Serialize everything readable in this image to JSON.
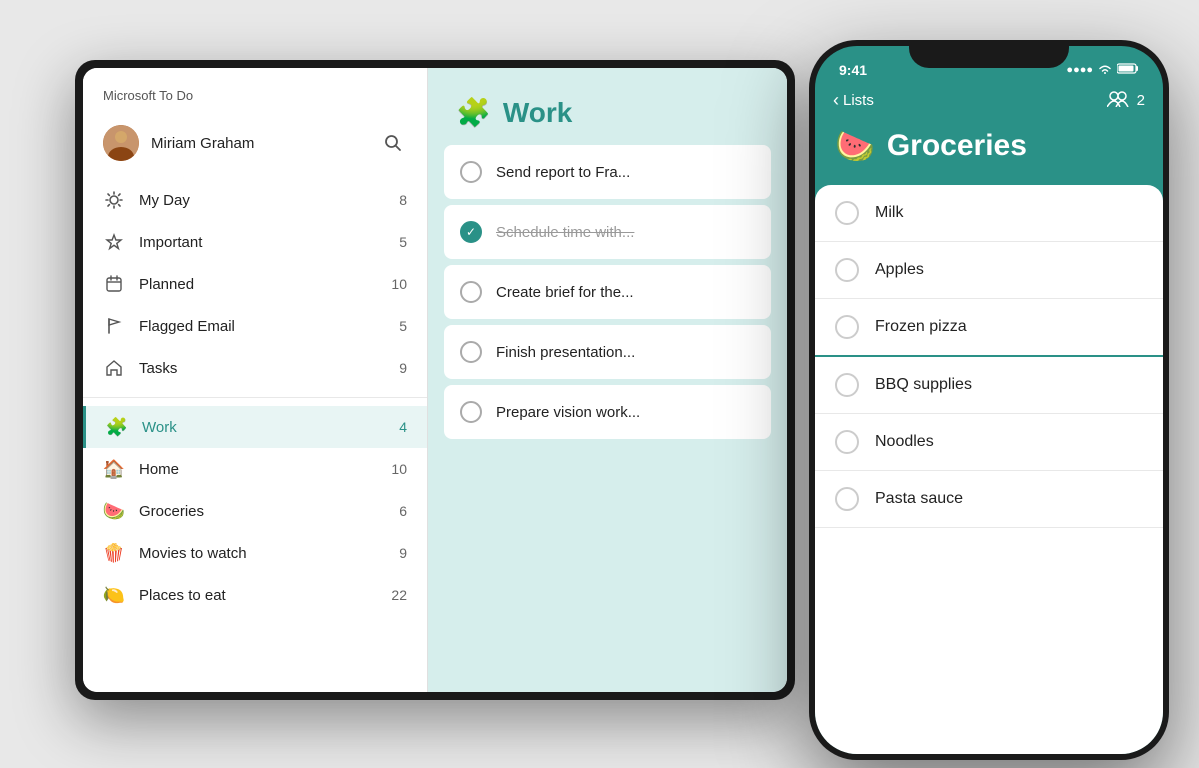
{
  "app": {
    "title": "Microsoft To Do"
  },
  "tablet": {
    "sidebar": {
      "app_title": "Microsoft To Do",
      "user": {
        "name": "Miriam Graham"
      },
      "nav_items": [
        {
          "id": "my-day",
          "icon": "sun",
          "label": "My Day",
          "count": "8"
        },
        {
          "id": "important",
          "icon": "star",
          "label": "Important",
          "count": "5"
        },
        {
          "id": "planned",
          "icon": "calendar",
          "label": "Planned",
          "count": "10"
        },
        {
          "id": "flagged-email",
          "icon": "flag",
          "label": "Flagged Email",
          "count": "5"
        },
        {
          "id": "tasks",
          "icon": "home",
          "label": "Tasks",
          "count": "9"
        }
      ],
      "lists": [
        {
          "id": "work",
          "emoji": "🧩",
          "label": "Work",
          "count": "4",
          "active": true
        },
        {
          "id": "home",
          "emoji": "🏠",
          "label": "Home",
          "count": "10"
        },
        {
          "id": "groceries",
          "emoji": "🍉",
          "label": "Groceries",
          "count": "6"
        },
        {
          "id": "movies",
          "emoji": "🍿",
          "label": "Movies to watch",
          "count": "9"
        },
        {
          "id": "places",
          "emoji": "🍋",
          "label": "Places to eat",
          "count": "22"
        }
      ]
    },
    "work_list": {
      "emoji": "🧩",
      "title": "Work",
      "tasks": [
        {
          "id": "t1",
          "text": "Send report to Fra...",
          "completed": false
        },
        {
          "id": "t2",
          "text": "Schedule time with...",
          "completed": true
        },
        {
          "id": "t3",
          "text": "Create brief for the...",
          "completed": false
        },
        {
          "id": "t4",
          "text": "Finish presentation...",
          "completed": false
        },
        {
          "id": "t5",
          "text": "Prepare vision work...",
          "completed": false
        }
      ]
    }
  },
  "phone": {
    "status_bar": {
      "time": "9:41",
      "signal": "●●●●",
      "wifi": "WiFi",
      "battery": "■"
    },
    "header": {
      "back_label": "Lists",
      "people_count": "2"
    },
    "groceries_list": {
      "emoji": "🍉",
      "title": "Groceries",
      "items": [
        {
          "id": "g1",
          "text": "Milk"
        },
        {
          "id": "g2",
          "text": "Apples"
        },
        {
          "id": "g3",
          "text": "Frozen pizza"
        },
        {
          "id": "g4",
          "text": "BBQ supplies"
        },
        {
          "id": "g5",
          "text": "Noodles"
        },
        {
          "id": "g6",
          "text": "Pasta sauce"
        }
      ]
    }
  },
  "colors": {
    "teal": "#2a9187",
    "teal_light": "#d6eeec",
    "sidebar_active_bg": "#e8f5f4"
  }
}
